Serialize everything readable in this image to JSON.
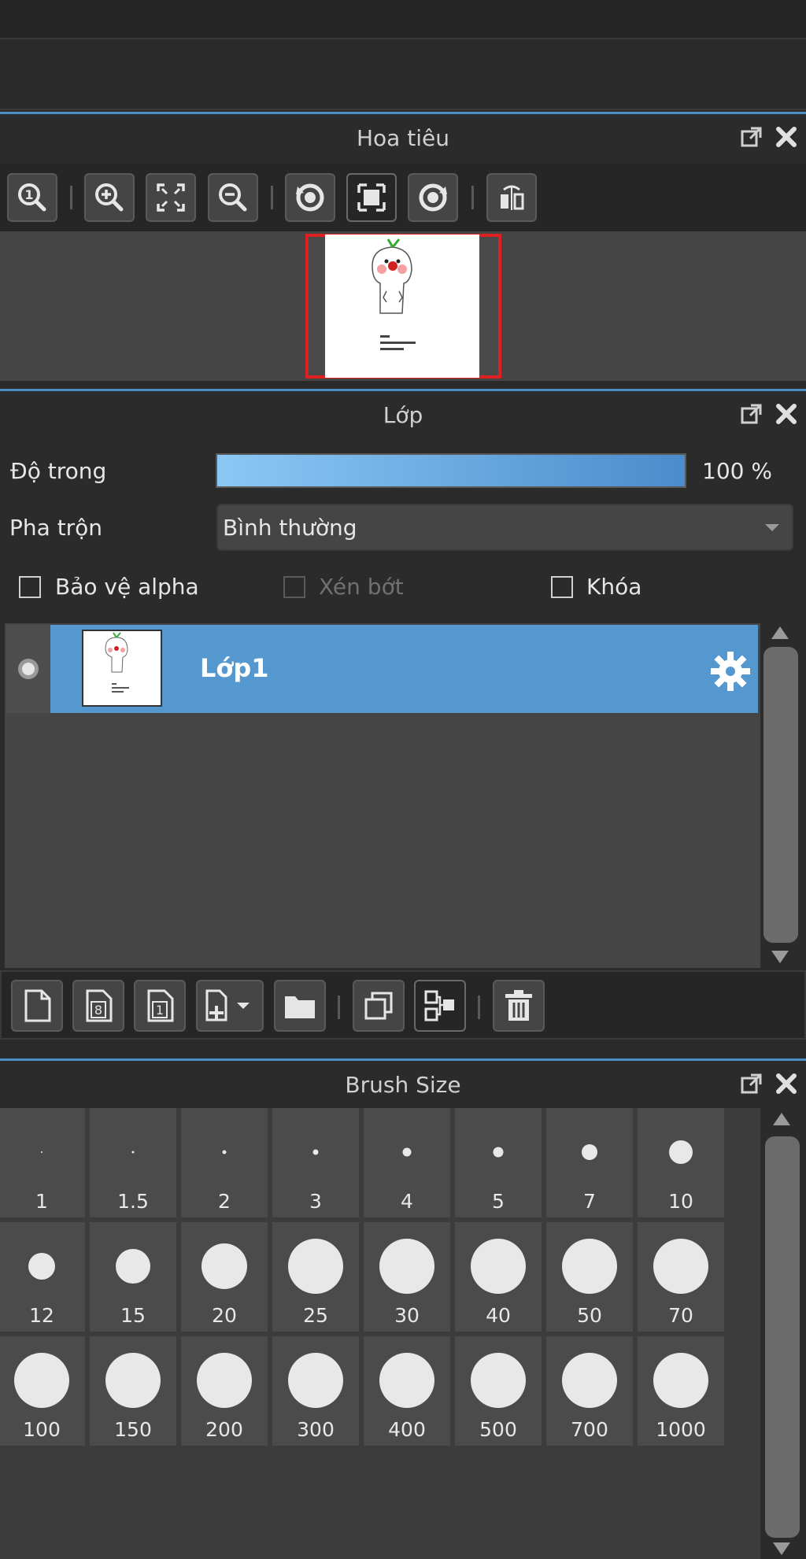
{
  "navigator": {
    "title": "Hoa tiêu",
    "icons": [
      "zoom-actual-icon",
      "zoom-in-icon",
      "fit-screen-icon",
      "zoom-out-icon",
      "rotate-left-icon",
      "reset-rotation-icon",
      "rotate-right-icon",
      "flip-horizontal-icon"
    ]
  },
  "layer_panel": {
    "title": "Lớp",
    "opacity_label": "Độ trong",
    "opacity_value": "100 %",
    "opacity_fraction": 1.0,
    "blend_label": "Pha trộn",
    "blend_value": "Bình thường",
    "protect_alpha_label": "Bảo vệ alpha",
    "clipping_label": "Xén bớt",
    "lock_label": "Khóa",
    "layers": [
      {
        "name": "Lớp1",
        "selected": true
      }
    ],
    "footer_icons": [
      "new-layer-icon",
      "new-8bit-layer-icon",
      "new-1bit-layer-icon",
      "add-layer-dropdown-icon",
      "new-folder-icon",
      "duplicate-layer-icon",
      "merge-layer-icon",
      "delete-layer-icon"
    ]
  },
  "brush_size": {
    "title": "Brush Size",
    "sizes": [
      {
        "label": "1",
        "value": 1
      },
      {
        "label": "1.5",
        "value": 1.5
      },
      {
        "label": "2",
        "value": 2
      },
      {
        "label": "3",
        "value": 3
      },
      {
        "label": "4",
        "value": 4
      },
      {
        "label": "5",
        "value": 5
      },
      {
        "label": "7",
        "value": 7
      },
      {
        "label": "10",
        "value": 10
      },
      {
        "label": "12",
        "value": 12
      },
      {
        "label": "15",
        "value": 15
      },
      {
        "label": "20",
        "value": 20
      },
      {
        "label": "25",
        "value": 25
      },
      {
        "label": "30",
        "value": 30
      },
      {
        "label": "40",
        "value": 40
      },
      {
        "label": "50",
        "value": 50
      },
      {
        "label": "70",
        "value": 70
      },
      {
        "label": "100",
        "value": 100
      },
      {
        "label": "150",
        "value": 150
      },
      {
        "label": "200",
        "value": 200
      },
      {
        "label": "300",
        "value": 300
      },
      {
        "label": "400",
        "value": 400
      },
      {
        "label": "500",
        "value": 500
      },
      {
        "label": "700",
        "value": 700
      },
      {
        "label": "1000",
        "value": 1000
      }
    ]
  },
  "colors": {
    "accent": "#4a90c8",
    "selected_row": "#5598cf",
    "panel_bg": "#2b2b2b"
  }
}
